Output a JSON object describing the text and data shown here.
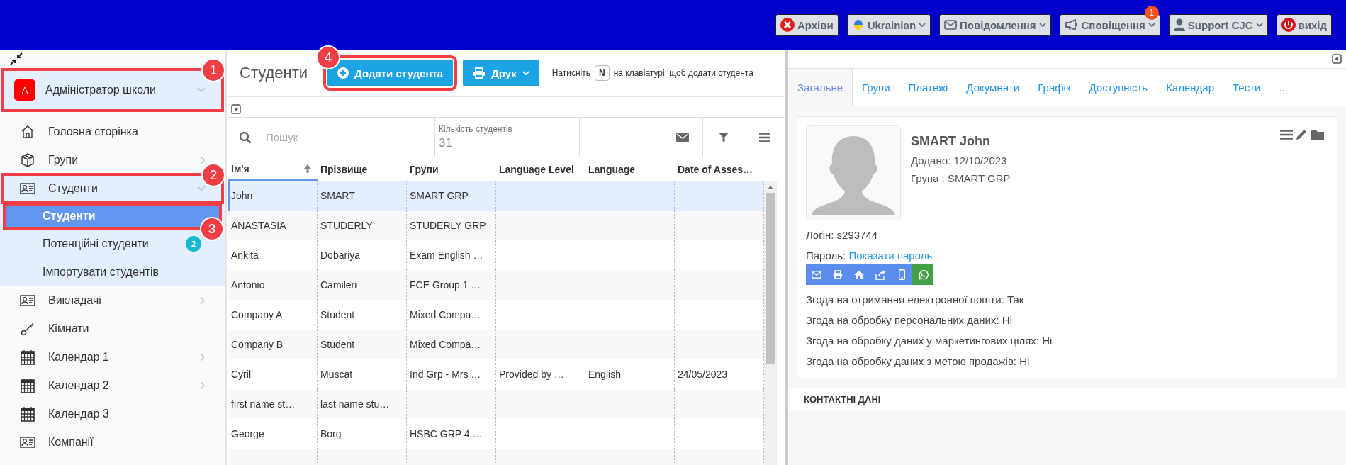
{
  "top_bar": {
    "buttons": [
      {
        "label": "Архіви",
        "dropdown": false
      },
      {
        "label": "Ukrainian",
        "dropdown": true
      },
      {
        "label": "Повідомлення",
        "dropdown": true
      },
      {
        "label": "Сповіщення",
        "dropdown": true,
        "badge": "1"
      },
      {
        "label": "Support CJC",
        "dropdown": true
      },
      {
        "label": "вихід",
        "dropdown": false
      }
    ]
  },
  "sidebar": {
    "header": {
      "avatar": "A",
      "label": "Адміністратор школи",
      "callout": "1"
    },
    "items": [
      {
        "label": "Головна сторінка"
      },
      {
        "label": "Групи",
        "expanded": false
      },
      {
        "label": "Студенти",
        "expanded": true,
        "callout": "2",
        "children": [
          {
            "label": "Студенти",
            "selected": true,
            "callout": "3"
          },
          {
            "label": "Потенційні студенти",
            "selected": false,
            "badge": "2"
          },
          {
            "label": "Імпортувати студентів",
            "selected": false
          }
        ]
      },
      {
        "label": "Викладачі",
        "expanded": false
      },
      {
        "label": "Кімнати"
      },
      {
        "label": "Календар 1",
        "expanded": false
      },
      {
        "label": "Календар 2",
        "expanded": false
      },
      {
        "label": "Календар 3"
      },
      {
        "label": "Компанії"
      }
    ]
  },
  "page": {
    "title": "Студенти",
    "add_button": {
      "label": "Додати студента",
      "callout": "4"
    },
    "print_button": {
      "label": "Друк"
    },
    "hint": {
      "before": "Натисніть",
      "key": "N",
      "after": "на клавіатурі, щоб додати студента"
    }
  },
  "table": {
    "search": {
      "placeholder": "Пошук"
    },
    "count_label": "Кількість студентів",
    "count": "31",
    "columns": [
      {
        "label": "Ім'я",
        "sorted": true
      },
      {
        "label": "Прізвище",
        "sorted": false
      },
      {
        "label": "Групи",
        "sorted": false
      },
      {
        "label": "Language Level",
        "sorted": false
      },
      {
        "label": "Language",
        "sorted": false
      },
      {
        "label": "Date of Asses…",
        "sorted": false
      }
    ],
    "rows": [
      {
        "selected": true,
        "cells": [
          "John",
          "SMART",
          "SMART GRP",
          "",
          "",
          ""
        ]
      },
      {
        "selected": false,
        "cells": [
          "ANASTASIA",
          "STUDERLY",
          "STUDERLY GRP",
          "",
          "",
          ""
        ]
      },
      {
        "selected": false,
        "cells": [
          "Ankita",
          "Dobariya",
          "Exam English …",
          "",
          "",
          ""
        ]
      },
      {
        "selected": false,
        "cells": [
          "Antonio",
          "Camileri",
          "FCE Group 1 …",
          "",
          "",
          ""
        ]
      },
      {
        "selected": false,
        "cells": [
          "Company A",
          "Student",
          "Mixed Compa…",
          "",
          "",
          ""
        ]
      },
      {
        "selected": false,
        "cells": [
          "Company B",
          "Student",
          "Mixed Compa…",
          "",
          "",
          ""
        ]
      },
      {
        "selected": false,
        "cells": [
          "Cyril",
          "Muscat",
          "Ind Grp - Mrs …",
          "Provided by …",
          "English",
          "24/05/2023"
        ]
      },
      {
        "selected": false,
        "cells": [
          "first name st…",
          "last name stu…",
          "",
          "",
          "",
          ""
        ]
      },
      {
        "selected": false,
        "cells": [
          "George",
          "Borg",
          "HSBC GRP 4,…",
          "",
          "",
          ""
        ]
      }
    ]
  },
  "details": {
    "tabs": [
      {
        "label": "Загальне",
        "selected": true
      },
      {
        "label": "Групи",
        "selected": false
      },
      {
        "label": "Платежі",
        "selected": false
      },
      {
        "label": "Документи",
        "selected": false
      },
      {
        "label": "Графік",
        "selected": false
      },
      {
        "label": "Доступність",
        "selected": false
      },
      {
        "label": "Календар",
        "selected": false
      },
      {
        "label": "Тести",
        "selected": false
      },
      {
        "label": "...",
        "selected": false
      }
    ],
    "name": "SMART John",
    "added": "Додано: 12/10/2023",
    "group": "Група : SMART GRP",
    "login": "Логін: s293744",
    "password_label": "Пароль:",
    "password_link": "Показати пароль",
    "consents": [
      "Згода на отримання електронної пошти: Так",
      "Згода на обробку персональних даних: Ні",
      "Згода на обробку даних у маркетингових цілях: Ні",
      "Згода на обробку даних з метою продажів: Ні"
    ],
    "section": "КОНТАКТНІ ДАНІ"
  }
}
